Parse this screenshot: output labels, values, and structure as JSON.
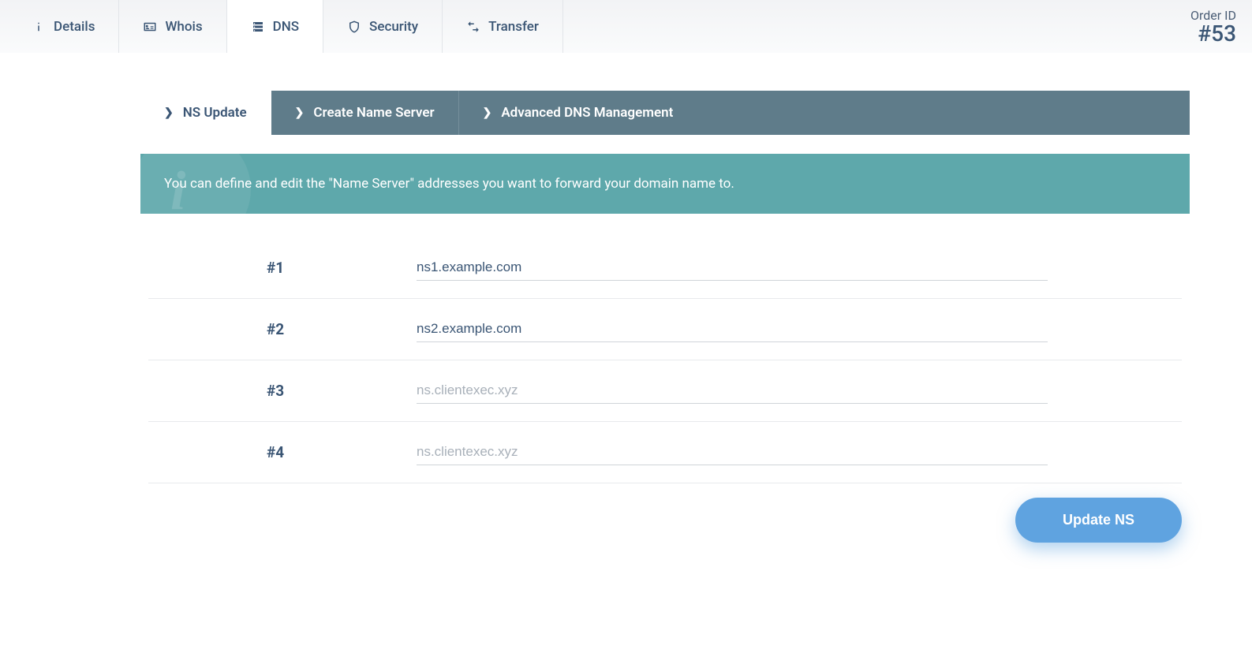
{
  "topTabs": {
    "details": "Details",
    "whois": "Whois",
    "dns": "DNS",
    "security": "Security",
    "transfer": "Transfer"
  },
  "order": {
    "label": "Order ID",
    "value": "#53"
  },
  "subTabs": {
    "nsUpdate": "NS Update",
    "createNS": "Create Name Server",
    "advanced": "Advanced DNS Management"
  },
  "info": {
    "text": "You can define and edit the \"Name Server\" addresses you want to forward your domain name to."
  },
  "nsForm": {
    "rows": [
      {
        "label": "#1",
        "value": "ns1.example.com",
        "placeholder": ""
      },
      {
        "label": "#2",
        "value": "ns2.example.com",
        "placeholder": ""
      },
      {
        "label": "#3",
        "value": "",
        "placeholder": "ns.clientexec.xyz"
      },
      {
        "label": "#4",
        "value": "",
        "placeholder": "ns.clientexec.xyz"
      }
    ],
    "submitLabel": "Update NS"
  }
}
